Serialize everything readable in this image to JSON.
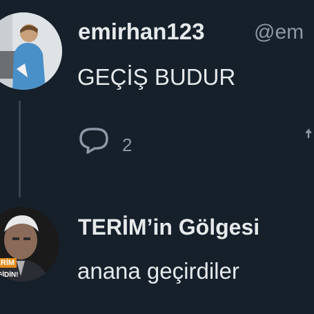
{
  "tweet1": {
    "display_name": "emirhan123",
    "handle": "@em",
    "text": "GEÇİŞ BUDUR",
    "reply_count": "2",
    "reply_icon": "speech-bubble-icon"
  },
  "tweet2": {
    "display_name": "TERİM’in Gölgesi",
    "text": "anana geçirdiler",
    "avatar_badge_top": "TERİM",
    "avatar_badge_bottom": "GİDİN!"
  },
  "colors": {
    "background": "#15202b",
    "primary_text": "#e7e9ea",
    "secondary_text": "#8b98a5",
    "thread_line": "#38444d",
    "badge_orange": "#e08a1a"
  }
}
